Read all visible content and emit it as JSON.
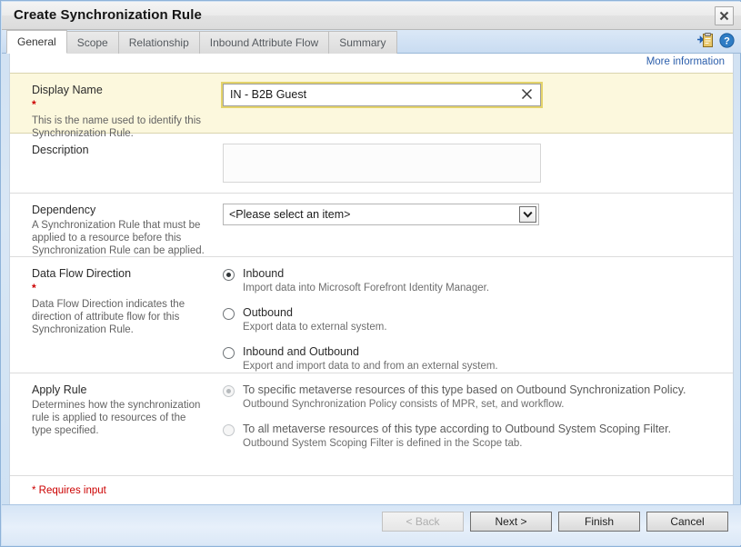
{
  "window": {
    "title": "Create Synchronization Rule",
    "close_label": "✖"
  },
  "tabs": [
    {
      "label": "General",
      "active": true
    },
    {
      "label": "Scope",
      "active": false
    },
    {
      "label": "Relationship",
      "active": false
    },
    {
      "label": "Inbound Attribute Flow",
      "active": false
    },
    {
      "label": "Summary",
      "active": false
    }
  ],
  "toolbar": {
    "add_clipboard_icon": "add-to-clipboard-icon",
    "help_icon": "help-icon"
  },
  "links": {
    "more_information": "More information"
  },
  "sections": {
    "display_name": {
      "title": "Display Name",
      "required_marker": "*",
      "description": "This is the name used to identify this Synchronization Rule.",
      "value": "IN - B2B Guest",
      "placeholder": "",
      "clear_icon": "clear-icon"
    },
    "description": {
      "title": "Description",
      "value": "",
      "placeholder": ""
    },
    "dependency": {
      "title": "Dependency",
      "description": "A Synchronization Rule that must be applied to a resource before this Synchronization Rule can be applied.",
      "selected": "<Please select an item>",
      "options": [
        "<Please select an item>"
      ],
      "dropdown_icon": "chevron-down-icon"
    },
    "data_flow_direction": {
      "title": "Data Flow Direction",
      "required_marker": "*",
      "description": "Data Flow Direction indicates the direction of attribute flow for this Synchronization Rule.",
      "options": [
        {
          "label": "Inbound",
          "sublabel": "Import data into Microsoft Forefront Identity Manager.",
          "selected": true,
          "disabled": false
        },
        {
          "label": "Outbound",
          "sublabel": "Export data to external system.",
          "selected": false,
          "disabled": false
        },
        {
          "label": "Inbound and Outbound",
          "sublabel": "Export and import data to and from an external system.",
          "selected": false,
          "disabled": false
        }
      ]
    },
    "apply_rule": {
      "title": "Apply Rule",
      "description": "Determines how the synchronization rule is applied to resources of the type specified.",
      "options": [
        {
          "label": "To specific metaverse resources of this type based on Outbound Synchronization Policy.",
          "sublabel": "Outbound Synchronization Policy consists of MPR, set, and workflow.",
          "selected": true,
          "disabled": true
        },
        {
          "label": "To all metaverse resources of this type according to Outbound System Scoping Filter.",
          "sublabel": "Outbound System Scoping Filter is defined in the Scope tab.",
          "selected": false,
          "disabled": true
        }
      ]
    }
  },
  "footer": {
    "requires_input_note": "* Requires input",
    "buttons": [
      {
        "label": "< Back",
        "disabled": true
      },
      {
        "label": "Next >",
        "disabled": false
      },
      {
        "label": "Finish",
        "disabled": false
      },
      {
        "label": "Cancel",
        "disabled": false
      }
    ]
  },
  "colors": {
    "accent_link": "#2b5eab",
    "required_red": "#cc0000",
    "highlight_bg": "#fcf8dd",
    "focus_outline": "#e4d36a"
  }
}
